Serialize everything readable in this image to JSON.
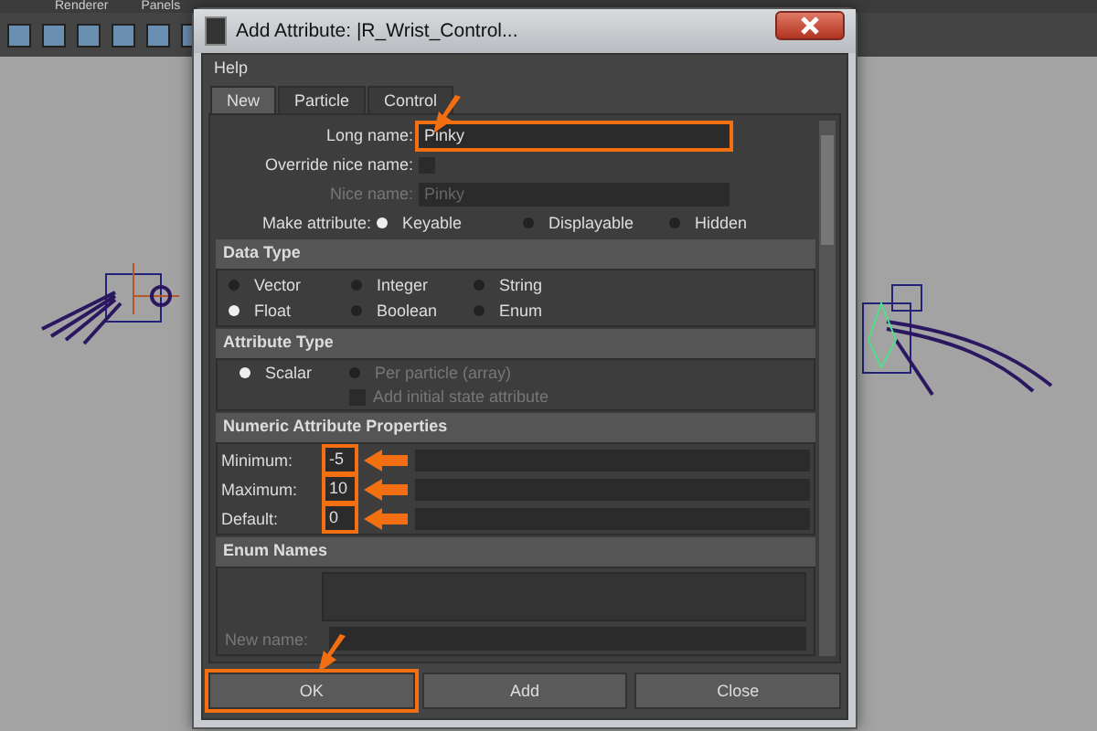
{
  "menu_bar": [
    "Renderer",
    "Panels"
  ],
  "dialog": {
    "title": "Add Attribute: |R_Wrist_Control...",
    "menu": [
      "Help"
    ],
    "tabs": [
      {
        "label": "New",
        "selected": true
      },
      {
        "label": "Particle",
        "selected": false
      },
      {
        "label": "Control",
        "selected": false
      }
    ],
    "long_name": {
      "label": "Long name:",
      "value": "Pinky",
      "highlighted": true
    },
    "override_nice_name": {
      "label": "Override nice name:",
      "checked": false
    },
    "nice_name": {
      "label": "Nice name:",
      "value": "Pinky",
      "disabled": true
    },
    "make_attribute": {
      "label": "Make attribute:",
      "options": [
        {
          "label": "Keyable",
          "selected": true
        },
        {
          "label": "Displayable",
          "selected": false
        },
        {
          "label": "Hidden",
          "selected": false
        }
      ]
    },
    "data_type": {
      "title": "Data Type",
      "options": [
        {
          "label": "Vector",
          "selected": false
        },
        {
          "label": "Integer",
          "selected": false
        },
        {
          "label": "String",
          "selected": false
        },
        {
          "label": "Float",
          "selected": true
        },
        {
          "label": "Boolean",
          "selected": false
        },
        {
          "label": "Enum",
          "selected": false
        }
      ]
    },
    "attribute_type": {
      "title": "Attribute Type",
      "options": [
        {
          "label": "Scalar",
          "selected": true,
          "disabled": false
        },
        {
          "label": "Per particle (array)",
          "selected": false,
          "disabled": true
        }
      ],
      "initial_state": {
        "label": "Add initial state attribute",
        "checked": false,
        "disabled": true
      }
    },
    "numeric": {
      "title": "Numeric Attribute Properties",
      "fields": [
        {
          "label": "Minimum:",
          "value": "-5",
          "highlighted": true
        },
        {
          "label": "Maximum:",
          "value": "10",
          "highlighted": true
        },
        {
          "label": "Default:",
          "value": "0",
          "highlighted": true
        }
      ]
    },
    "enum_names": {
      "title": "Enum Names",
      "new_name": {
        "label": "New name:",
        "disabled": true
      }
    },
    "buttons": [
      {
        "label": "OK",
        "highlighted": true
      },
      {
        "label": "Add",
        "highlighted": false
      },
      {
        "label": "Close",
        "highlighted": false
      }
    ]
  }
}
